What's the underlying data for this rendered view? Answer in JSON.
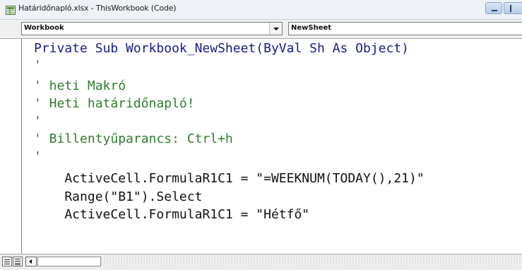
{
  "window": {
    "title": "Határidőnapló.xlsx - ThisWorkbook (Code)"
  },
  "selectors": {
    "object": "Workbook",
    "procedure": "NewSheet"
  },
  "code": {
    "lines": [
      {
        "text": "Private Sub Workbook_NewSheet(ByVal Sh As Object)",
        "kind": "keyword"
      },
      {
        "text": "'",
        "kind": "comment"
      },
      {
        "text": "' heti Makró",
        "kind": "comment"
      },
      {
        "text": "' Heti határidőnapló!",
        "kind": "comment"
      },
      {
        "text": "'",
        "kind": "comment"
      },
      {
        "text": "' Billentyűparancs: Ctrl+h",
        "kind": "comment"
      },
      {
        "text": "'",
        "kind": "comment"
      },
      {
        "text": "    ActiveCell.FormulaR1C1 = \"=WEEKNUM(TODAY(),21)\"",
        "kind": "text"
      },
      {
        "text": "    Range(\"B1\").Select",
        "kind": "text"
      },
      {
        "text": "    ActiveCell.FormulaR1C1 = \"Hétfő\"",
        "kind": "text"
      }
    ]
  },
  "colors": {
    "keyword": "#1a1a8c",
    "comment": "#2f7d2f",
    "text": "#111111"
  },
  "icons": {
    "title": "excel-workbook-icon",
    "minimize": "minimize-icon",
    "maximize": "maximize-icon"
  }
}
